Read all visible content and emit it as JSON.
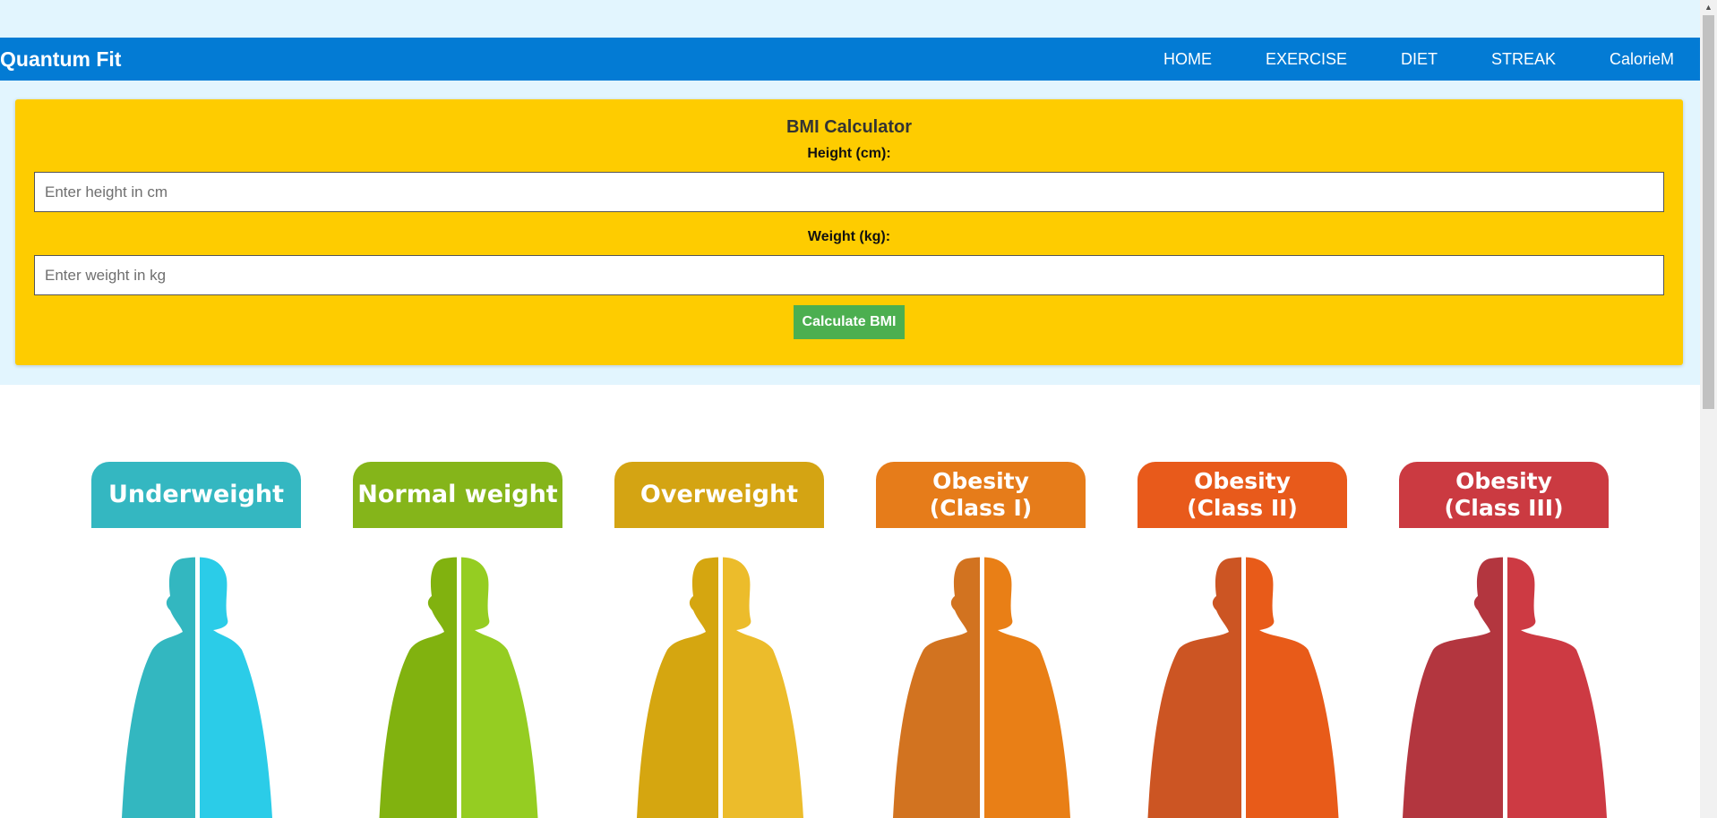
{
  "brand": "Quantum Fit",
  "nav": {
    "items": [
      {
        "label": "HOME"
      },
      {
        "label": "EXERCISE"
      },
      {
        "label": "DIET"
      },
      {
        "label": "STREAK"
      },
      {
        "label": "CalorieM"
      }
    ]
  },
  "bmi_form": {
    "title": "BMI Calculator",
    "height_label": "Height (cm):",
    "height_placeholder": "Enter height in cm",
    "weight_label": "Weight (kg):",
    "weight_placeholder": "Enter weight in kg",
    "button_label": "Calculate BMI"
  },
  "bmi_categories": [
    {
      "line1": "Underweight",
      "line2": "",
      "tab_color": "#34b7c1",
      "dark": "#33b7c0",
      "light": "#2bcce8"
    },
    {
      "line1": "Normal weight",
      "line2": "",
      "tab_color": "#85b51a",
      "dark": "#81b20f",
      "light": "#95cd22"
    },
    {
      "line1": "Overweight",
      "line2": "",
      "tab_color": "#d4a413",
      "dark": "#d5a610",
      "light": "#ecbc2b"
    },
    {
      "line1": "Obesity",
      "line2": "(Class I)",
      "tab_color": "#e67c1a",
      "dark": "#d27320",
      "light": "#e97f16"
    },
    {
      "line1": "Obesity",
      "line2": "(Class II)",
      "tab_color": "#e85a1b",
      "dark": "#cc5523",
      "light": "#e85b19"
    },
    {
      "line1": "Obesity",
      "line2": "(Class III)",
      "tab_color": "#cb3a41",
      "dark": "#b3363f",
      "light": "#cd3a43"
    }
  ],
  "colors": {
    "page_band": "#e2f5fe",
    "navbar": "#037bd4",
    "card": "#fecc00",
    "button": "#4caf50"
  }
}
